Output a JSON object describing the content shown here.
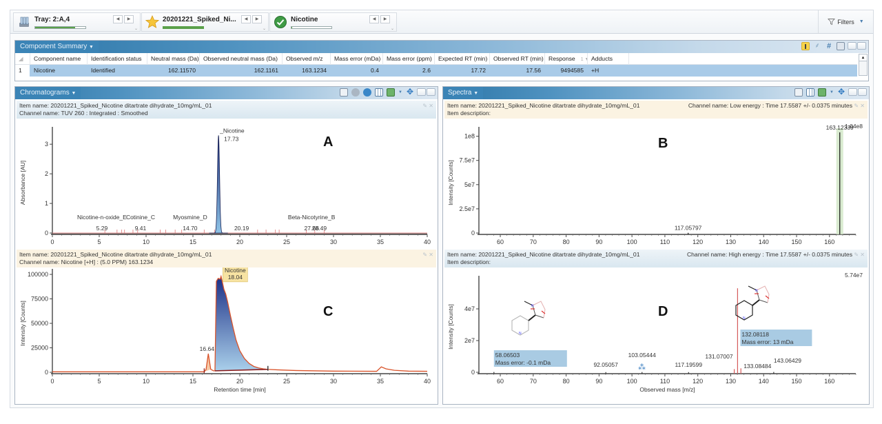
{
  "toolbar": {
    "selectors": [
      {
        "title": "Tray: 2:A,4",
        "icon": "tray-vials-icon",
        "progress": 0.8
      },
      {
        "title": "20201221_Spiked_Ni...",
        "icon": "star-icon",
        "progress": 1.0
      },
      {
        "title": "Nicotine",
        "icon": "check-circle-icon",
        "progress": 0.02
      }
    ],
    "filters_label": "Filters"
  },
  "component_summary": {
    "tab_label": "Component Summary",
    "columns": [
      "",
      "Component name",
      "Identification status",
      "Neutral mass (Da)",
      "Observed neutral mass (Da)",
      "Observed m/z",
      "Mass error (mDa)",
      "Mass error (ppm)",
      "Expected RT (min)",
      "Observed RT (min)",
      "Response",
      "Adducts"
    ],
    "sort_indicator": "1",
    "rows": [
      [
        "1",
        "Nicotine",
        "Identified",
        "162.11570",
        "162.1161",
        "163.1234",
        "0.4",
        "2.6",
        "17.72",
        "17.56",
        "9494585",
        "+H"
      ]
    ]
  },
  "chromatograms": {
    "tab_label": "Chromatograms",
    "top": {
      "item_name": "Item name: 20201221_Spiked_Nicotine ditartrate dihydrate_10mg/mL_01",
      "channel": "Channel name: TUV 260 : Integrated : Smoothed"
    },
    "bottom": {
      "item_name": "Item name: 20201221_Spiked_Nicotine ditartrate dihydrate_10mg/mL_01",
      "channel": "Channel name: Nicotine [+H] : (5.0 PPM) 163.1234"
    }
  },
  "spectra": {
    "tab_label": "Spectra",
    "top": {
      "item_name": "Item name: 20201221_Spiked_Nicotine ditartrate dihydrate_10mg/mL_01",
      "item_description": "Item description:",
      "channel": "Channel name: Low energy : Time 17.5587 +/- 0.0375 minutes"
    },
    "bottom": {
      "item_name": "Item name: 20201221_Spiked_Nicotine ditartrate dihydrate_10mg/mL_01",
      "item_description": "Item description:",
      "channel": "Channel name: High energy : Time 17.5587 +/- 0.0375 minutes"
    }
  },
  "chart_data": [
    {
      "id": "A",
      "type": "line",
      "panel_letter": "A",
      "title": "",
      "xlabel": "",
      "ylabel": "Absorbance [AU]",
      "xlim": [
        0,
        40
      ],
      "ylim": [
        0,
        3.4
      ],
      "xticks": [
        0,
        5,
        10,
        15,
        20,
        25,
        30,
        35,
        40
      ],
      "yticks": [
        0,
        1,
        2,
        3
      ],
      "peaks": [
        {
          "label": "Nicotine",
          "rt": 17.73,
          "height": 3.3,
          "width": 0.35,
          "main": true
        },
        {
          "label": "Nicotine-n-oxide_E",
          "rt": 5.29,
          "height": 0.005
        },
        {
          "label": "Cotinine_C",
          "rt": 9.41,
          "height": 0.005
        },
        {
          "label": "Myosmine_D",
          "rt": 14.7,
          "height": 0.005
        },
        {
          "label": "",
          "rt": 20.19,
          "height": 0.005
        },
        {
          "label": "Beta-Nicotyrine_B",
          "rt": 27.66,
          "height": 0.005
        },
        {
          "label": "",
          "rt": 28.49,
          "height": 0.005
        }
      ],
      "integration_marks": [
        5.6,
        6.9,
        7.4,
        7.7,
        8.6,
        9.1,
        11.5,
        12.1,
        13.1,
        13.8,
        16.2,
        17.3,
        21.9,
        22.8,
        23.8,
        24.2,
        27.1,
        28.0,
        29.0
      ]
    },
    {
      "id": "B",
      "type": "bar",
      "panel_letter": "B",
      "xlabel": "",
      "ylabel": "Intensity [Counts]",
      "xlim": [
        53.5,
        168
      ],
      "ylim": [
        0,
        104000000.0
      ],
      "max_label": "1.04e8",
      "xticks": [
        60,
        70,
        80,
        90,
        100,
        110,
        120,
        130,
        140,
        150,
        160
      ],
      "yticks": [
        0,
        25000000,
        50000000,
        75000000,
        100000000
      ],
      "ytick_labels": [
        "0",
        "2.5e7",
        "5e7",
        "7.5e7",
        "1e8"
      ],
      "peaks": [
        {
          "mz": 117.05797,
          "intensity": 200000,
          "label": "117.05797"
        },
        {
          "mz": 163.12339,
          "intensity": 104000000.0,
          "label": "163.12339",
          "highlight": true
        }
      ]
    },
    {
      "id": "C",
      "type": "area",
      "panel_letter": "C",
      "xlabel": "Retention time [min]",
      "ylabel": "Intensity [Counts]",
      "xlim": [
        0,
        40
      ],
      "ylim": [
        0,
        100000
      ],
      "xticks": [
        0,
        5,
        10,
        15,
        20,
        25,
        30,
        35,
        40
      ],
      "yticks": [
        0,
        25000,
        50000,
        75000,
        100000
      ],
      "annotations": [
        {
          "label": "16.64",
          "rt": 16.64,
          "intensity": 19000
        },
        {
          "label": "Nicotine",
          "sublabel": "18.04",
          "rt": 18.04,
          "intensity": 98000,
          "boxed": true
        }
      ],
      "series": [
        {
          "name": "trace",
          "x": [
            0,
            16.2,
            16.4,
            16.64,
            16.9,
            17.2,
            17.35,
            17.5,
            17.7,
            17.9,
            18.0,
            18.1,
            18.3,
            18.5,
            18.7,
            19.0,
            19.3,
            19.6,
            20.0,
            20.5,
            21.0,
            21.5,
            22.0,
            22.5,
            23.0,
            24,
            26,
            30,
            34.6,
            35.1,
            35.6,
            36.5,
            38,
            40
          ],
          "y": [
            500,
            500,
            3000,
            19000,
            3000,
            1500,
            1500,
            93000,
            96000,
            95000,
            98000,
            94000,
            85000,
            80000,
            72000,
            58000,
            45000,
            33000,
            22000,
            14000,
            9000,
            6000,
            4500,
            3500,
            3000,
            2500,
            1800,
            1200,
            1000,
            5500,
            3500,
            2000,
            1200,
            1000
          ]
        }
      ]
    },
    {
      "id": "D",
      "type": "bar",
      "panel_letter": "D",
      "xlabel": "Observed mass [m/z]",
      "ylabel": "Intensity [Counts]",
      "xlim": [
        53.5,
        168
      ],
      "ylim": [
        0,
        57400000.0
      ],
      "max_label": "5.74e7",
      "xticks": [
        60,
        70,
        80,
        90,
        100,
        110,
        120,
        130,
        140,
        150,
        160
      ],
      "yticks": [
        0,
        20000000,
        40000000
      ],
      "ytick_labels": [
        "0",
        "2e7",
        "4e7"
      ],
      "peaks": [
        {
          "mz": 58.06503,
          "intensity": 200000,
          "label": "58.06503",
          "fragment": true,
          "mass_error": "Mass error: -0.1 mDa"
        },
        {
          "mz": 92.05057,
          "intensity": 100000,
          "label": "92.05057"
        },
        {
          "mz": 103.05444,
          "intensity": 150000,
          "label": "103.05444"
        },
        {
          "mz": 117.19599,
          "intensity": 100000,
          "label": "117.19599"
        },
        {
          "mz": 131.07007,
          "intensity": 2000000,
          "label": "131.07007"
        },
        {
          "mz": 132.08118,
          "intensity": 53000000.0,
          "label": "132.08118",
          "fragment": true,
          "mass_error": "Mass error: 13 mDa"
        },
        {
          "mz": 133.08484,
          "intensity": 2500000,
          "label": "133.08484"
        },
        {
          "mz": 143.06429,
          "intensity": 200000,
          "label": "143.06429"
        }
      ]
    }
  ]
}
